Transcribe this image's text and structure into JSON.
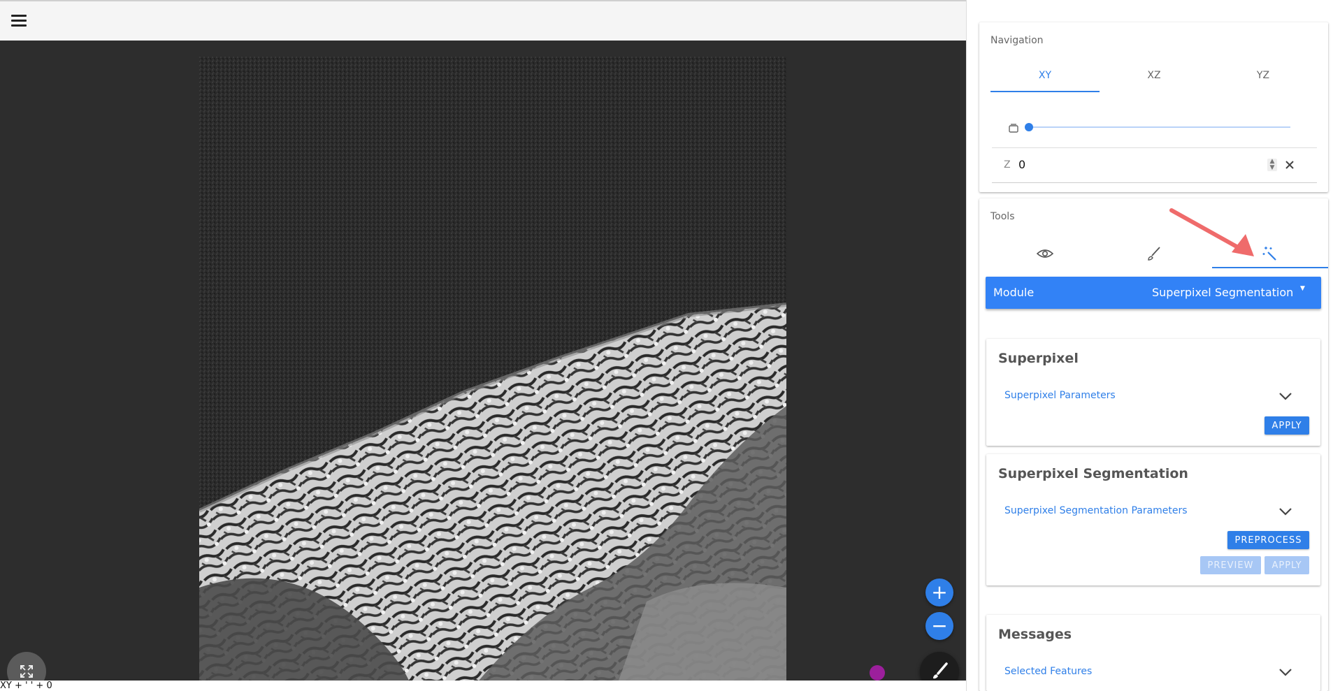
{
  "toolbar": {
    "menu_icon": "hamburger-menu-icon"
  },
  "viewer": {
    "status_text": "XY + ' ' + 0",
    "zoom_in_label": "+",
    "zoom_out_label": "−",
    "brush_icon": "brush-icon",
    "fullscreen_icon": "fullscreen-icon",
    "marker_color": "#9c1f9c"
  },
  "navigation": {
    "title": "Navigation",
    "tabs": [
      {
        "label": "XY",
        "active": true
      },
      {
        "label": "XZ",
        "active": false
      },
      {
        "label": "YZ",
        "active": false
      }
    ],
    "slider_icon": "layers-icon",
    "slider_value": 0,
    "z_label": "Z",
    "z_value": "0",
    "clear_icon": "close-icon"
  },
  "tools": {
    "title": "Tools",
    "tabs": [
      {
        "icon": "eye-icon"
      },
      {
        "icon": "brush-icon"
      },
      {
        "icon": "magic-wand-icon",
        "active": true
      }
    ],
    "module_label": "Module",
    "module_value": "Superpixel Segmentation"
  },
  "superpixel": {
    "title": "Superpixel",
    "params_label": "Superpixel Parameters",
    "apply_label": "APPLY"
  },
  "superpixel_segmentation": {
    "title": "Superpixel Segmentation",
    "params_label": "Superpixel Segmentation Parameters",
    "preprocess_label": "PREPROCESS",
    "preview_label": "PREVIEW",
    "apply_label": "APPLY"
  },
  "messages": {
    "title": "Messages",
    "selected_label": "Selected Features"
  },
  "colors": {
    "accent": "#2f7fe8",
    "module_bar": "#3282f6",
    "viewer_bg": "#2d2d2d",
    "arrow": "#ef6b6b"
  }
}
